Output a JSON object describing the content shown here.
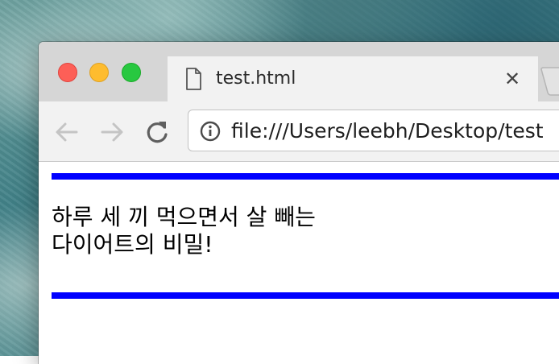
{
  "browser": {
    "tab": {
      "title": "test.html",
      "close_symbol": "✕",
      "icon": "document-icon"
    },
    "toolbar": {
      "back_icon": "arrow-left-icon",
      "forward_icon": "arrow-right-icon",
      "reload_icon": "reload-icon",
      "site_info_icon": "info-icon",
      "url": "file:///Users/leebh/Desktop/test"
    }
  },
  "page": {
    "headline_line1": "하루 세 끼 먹으면서 살 빼는",
    "headline_line2": "다이어트의 비밀!",
    "rule_color": "#0000ff"
  },
  "colors": {
    "close": "#fd5f57",
    "minimize": "#febc2e",
    "maximize": "#28c840"
  }
}
